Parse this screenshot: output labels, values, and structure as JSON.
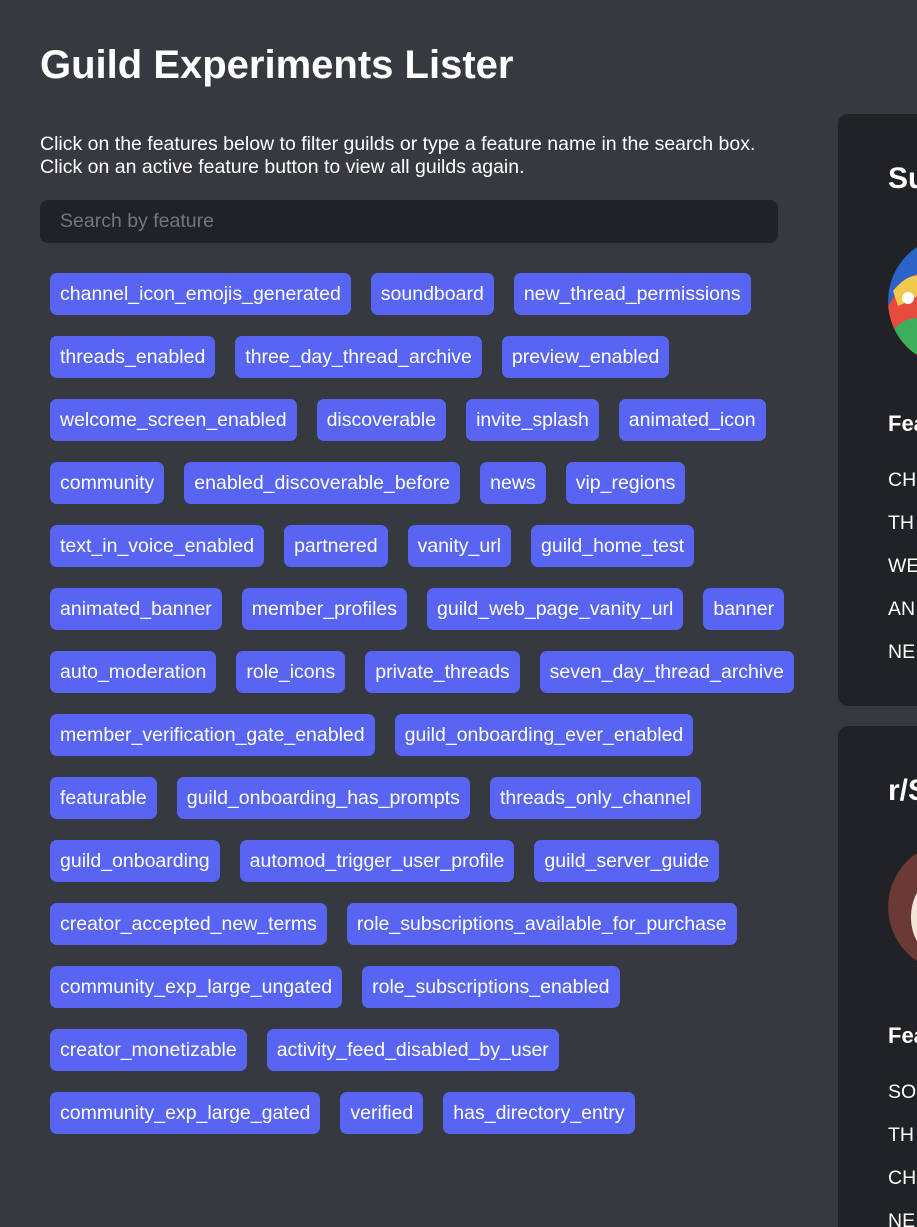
{
  "page_title": "Guild Experiments Lister",
  "instructions": {
    "line1": "Click on the features below to filter guilds or type a feature name in the search box.",
    "line2": "Click on an active feature button to view all guilds again."
  },
  "search": {
    "placeholder": "Search by feature"
  },
  "features": [
    "channel_icon_emojis_generated",
    "soundboard",
    "new_thread_permissions",
    "threads_enabled",
    "three_day_thread_archive",
    "preview_enabled",
    "welcome_screen_enabled",
    "discoverable",
    "invite_splash",
    "animated_icon",
    "community",
    "enabled_discoverable_before",
    "news",
    "vip_regions",
    "text_in_voice_enabled",
    "partnered",
    "vanity_url",
    "guild_home_test",
    "animated_banner",
    "member_profiles",
    "guild_web_page_vanity_url",
    "banner",
    "auto_moderation",
    "role_icons",
    "private_threads",
    "seven_day_thread_archive",
    "member_verification_gate_enabled",
    "guild_onboarding_ever_enabled",
    "featurable",
    "guild_onboarding_has_prompts",
    "threads_only_channel",
    "guild_onboarding",
    "automod_trigger_user_profile",
    "guild_server_guide",
    "creator_accepted_new_terms",
    "role_subscriptions_available_for_purchase",
    "community_exp_large_ungated",
    "role_subscriptions_enabled",
    "creator_monetizable",
    "activity_feed_disabled_by_user",
    "community_exp_large_gated",
    "verified",
    "has_directory_entry"
  ],
  "guild_cards": [
    {
      "name": "Su",
      "features_heading": "Fea",
      "feature_items": [
        "CH",
        "TH",
        "WE",
        "AN",
        "NE"
      ]
    },
    {
      "name": "r/S",
      "features_heading": "Fea",
      "feature_items": [
        "SO",
        "TH",
        "CH",
        "NE"
      ]
    }
  ],
  "colors": {
    "background": "#36393f",
    "card_background": "#202225",
    "search_background": "#202225",
    "feature_button": "#5865f2",
    "text": "#ffffff"
  }
}
